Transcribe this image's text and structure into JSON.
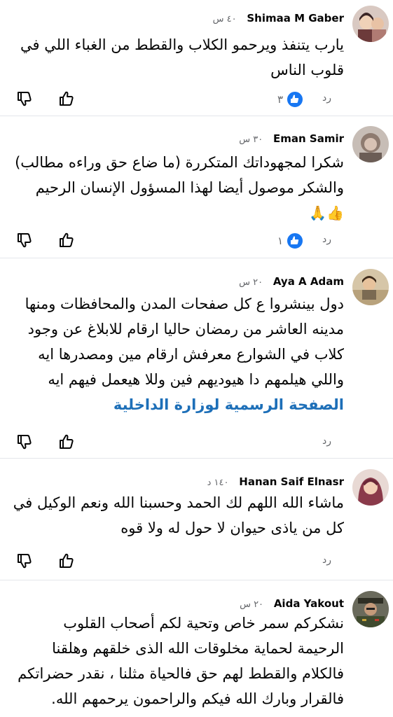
{
  "comments": [
    {
      "author": "Shimaa M Gaber",
      "time": "٤٠ س",
      "lines": [
        "يارب يتنفذ ويرحمو الكلاب والقطط من الغباء اللي في",
        "قلوب الناس"
      ],
      "reply_label": "رد",
      "reaction_count": "٣"
    },
    {
      "author": "Eman Samir",
      "time": "٣٠ س",
      "lines": [
        "شكرا لمجهوداتك المتكررة (ما ضاع حق وراءه مطالب)",
        "والشكر موصول أيضا لهذا المسؤول  الإنسان الرحيم"
      ],
      "emoji": "👍🙏",
      "reply_label": "رد",
      "reaction_count": "١"
    },
    {
      "author": "Aya A Adam",
      "time": "٢٠ س",
      "lines": [
        "دول بينشروا ع كل صفحات المدن والمحافظات ومنها",
        "مدينه العاشر من رمضان حاليا ارقام للابلاغ عن وجود",
        "كلاب في الشوارع معرفش ارقام مين ومصدرها ايه",
        "واللي هيلمهم دا هيوديهم فين وللا هيعمل فيهم ايه"
      ],
      "link": "الصفحة الرسمية لوزارة الداخلية",
      "reply_label": "رد"
    },
    {
      "author": "Hanan Saif Elnasr",
      "time": "١٤٠ د",
      "lines": [
        "ماشاء الله اللهم لك الحمد وحسبنا الله ونعم الوكيل في",
        "كل من ياذى حيوان لا حول له ولا قوه"
      ],
      "reply_label": "رد"
    },
    {
      "author": "Aida Yakout",
      "time": "٢٠ س",
      "lines": [
        "نشكركم سمر خاص وتحية لكم أصحاب القلوب",
        "الرحيمة لحماية مخلوقات الله الذى خلقهم وهلقنا",
        "فالكلام والقطط لهم حق فالحياة مثلنا ، نقدر حضراتكم",
        "فالقرار وبارك الله فيكم والراحمون يرحمهم الله."
      ]
    }
  ],
  "icons": {
    "like": "thumbs-up-outline-icon",
    "dislike": "thumbs-down-outline-icon",
    "reaction": "like-reaction-icon"
  },
  "colors": {
    "link": "#1d6fb8",
    "reaction_blue": "#1877f2",
    "meta_gray": "#65676b"
  }
}
